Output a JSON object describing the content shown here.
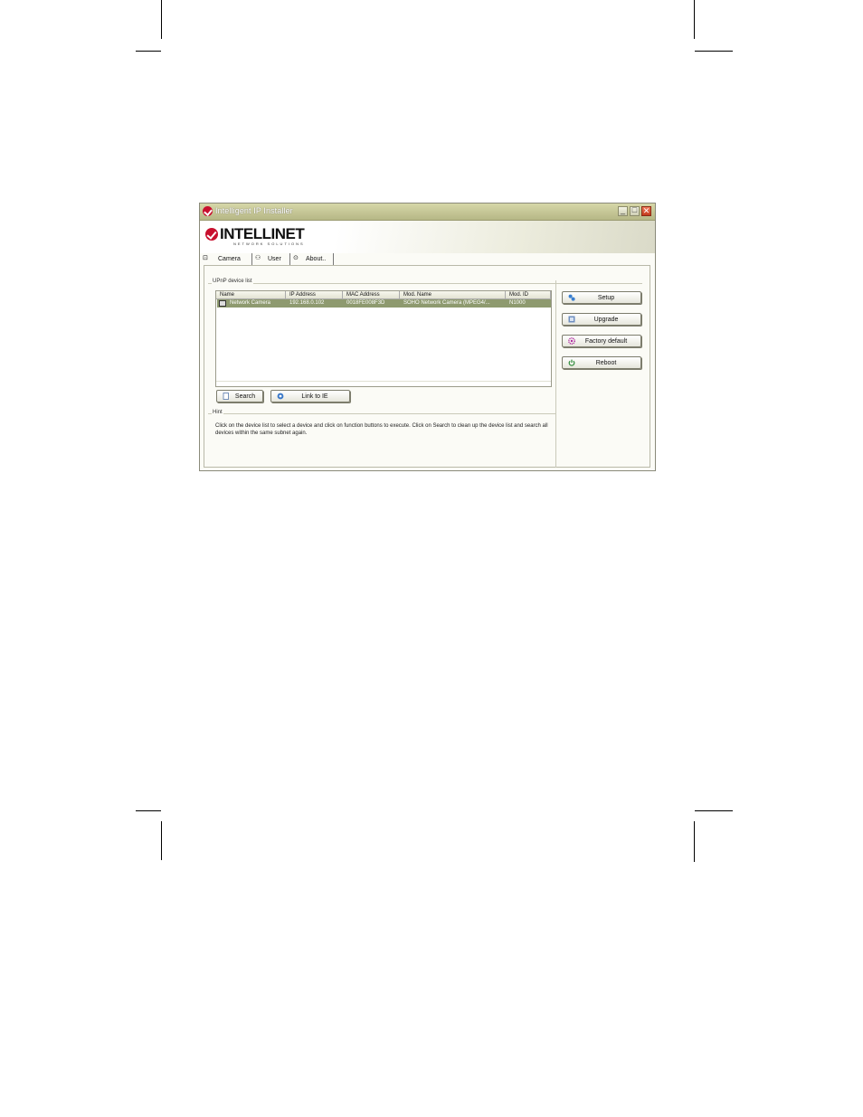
{
  "window": {
    "title": "Intelligent IP Installer",
    "minimize": "_",
    "maximize": "□",
    "close": "✕"
  },
  "logo": {
    "name": "INTELLINET",
    "tagline": "NETWORK SOLUTIONS"
  },
  "tabs": [
    {
      "label": "Camera",
      "icon": "camera-icon",
      "glyph": "⊡"
    },
    {
      "label": "User",
      "icon": "user-icon",
      "glyph": "⚇"
    },
    {
      "label": "About..",
      "icon": "info-icon",
      "glyph": "⊙"
    }
  ],
  "device_list": {
    "group_label": "UPnP device list",
    "columns": [
      "Name",
      "IP Address",
      "MAC Address",
      "Mod. Name",
      "Mod. ID"
    ],
    "rows": [
      {
        "name": "Network Camera",
        "ip": "192.168.0.102",
        "mac": "0018FE008F3D",
        "mod_name": "SOHO Network Camera (MPEG4/...",
        "mod_id": "N1000"
      }
    ]
  },
  "buttons": {
    "search": "Search",
    "link_ie": "Link to IE",
    "setup": "Setup",
    "upgrade": "Upgrade",
    "factory_default": "Factory default",
    "reboot": "Reboot"
  },
  "hint": {
    "label": "Hint",
    "text": "Click on the device list to select a device and click on function buttons to execute. Click on Search to clean up the device list and search all devices within the same subnet again."
  },
  "colors": {
    "title_bar": "#c6c797",
    "selected_row": "#8e9a6f",
    "brand_red": "#c8102e"
  }
}
